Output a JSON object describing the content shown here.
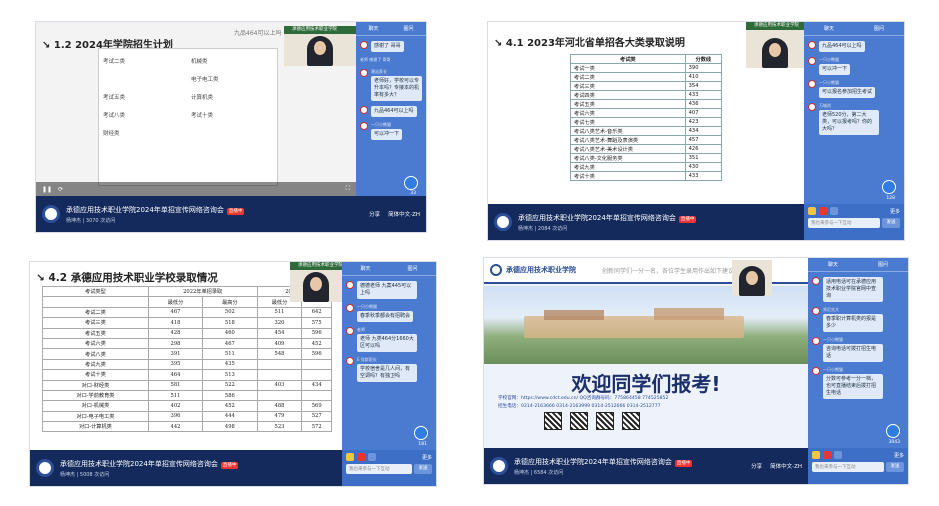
{
  "footer": {
    "title": "承德应用技术职业学院2024年单招宣传网络咨询会",
    "live": "直播中",
    "author": "杨坤杰",
    "visits": [
      "3070 次访问",
      "2084 次访问",
      "5008 次访问",
      "6584 次访问"
    ],
    "share": "分享",
    "lang": "简体中文-ZH",
    "more": "更多"
  },
  "chat": {
    "tabs": [
      "聊天",
      "图问"
    ],
    "placeholder": "我也来参与一下互动",
    "send": "发送"
  },
  "webcam_label": "承德应用技术职业学院",
  "panel1": {
    "title": "1.2  2024年学院招生计划",
    "overlay": "九品464可以上吗",
    "doc_heads": [
      "考试二类",
      "机械类",
      "电子电工类",
      "考试五类",
      "计算机类",
      "考试八类",
      "考试十类",
      "财经类"
    ],
    "messages": [
      {
        "user": "",
        "text": "感谢了 哥哥"
      },
      {
        "user": "老师 感谢了 哥哥",
        "text": ""
      },
      {
        "user": "潮汕家长",
        "text": "老师好，学校可以专升本吗？专接本的机率有多大？"
      },
      {
        "user": "",
        "text": "九品464可以上吗"
      },
      {
        "user": "一只小熊猫",
        "text": "可以冲一下"
      }
    ],
    "likes": "33"
  },
  "panel2": {
    "title": "4.1 2023年河北省单招各大类录取说明",
    "table": {
      "headers": [
        "考试类",
        "分数线"
      ],
      "rows": [
        [
          "考试一类",
          "390"
        ],
        [
          "考试二类",
          "410"
        ],
        [
          "考试三类",
          "354"
        ],
        [
          "考试四类",
          "433"
        ],
        [
          "考试五类",
          "436"
        ],
        [
          "考试六类",
          "407"
        ],
        [
          "考试七类",
          "423"
        ],
        [
          "考试八类艺术-音乐类",
          "434"
        ],
        [
          "考试八类艺术-舞蹈及表演类",
          "457"
        ],
        [
          "考试八类艺术-美术设计类",
          "426"
        ],
        [
          "考试八类-文化服务类",
          "351"
        ],
        [
          "考试九类",
          "430"
        ],
        [
          "考试十类",
          "433"
        ]
      ]
    },
    "messages": [
      {
        "user": "",
        "text": "九品464可以上吗"
      },
      {
        "user": "一只小熊猫",
        "text": "可以冲一下"
      },
      {
        "user": "一只小熊猫",
        "text": "可以报名参加招生考试"
      },
      {
        "user": "万城尚",
        "text": "老师520分，第二大类，可以报考吗？你的大吗？"
      }
    ],
    "likes": "128"
  },
  "panel3": {
    "title": "4.2 承德应用技术职业学校录取情况",
    "table": {
      "headers": [
        "考试类型",
        "2022年单招录取",
        "",
        "2023年",
        ""
      ],
      "sub": [
        "",
        "最低分",
        "最高分",
        "最低分",
        ""
      ],
      "rows": [
        [
          "考试二类",
          "467",
          "502",
          "511",
          "642"
        ],
        [
          "考试三类",
          "418",
          "518",
          "320",
          "575"
        ],
        [
          "考试五类",
          "428",
          "460",
          "454",
          "596"
        ],
        [
          "考试六类",
          "298",
          "467",
          "409",
          "452"
        ],
        [
          "考试八类",
          "391",
          "511",
          "548",
          "596"
        ],
        [
          "考试九类",
          "395",
          "435",
          "",
          ""
        ],
        [
          "考试十类",
          "464",
          "513",
          "",
          ""
        ],
        [
          "对口-财经类",
          "581",
          "522",
          "403",
          "434"
        ],
        [
          "对口-学前教育类",
          "511",
          "586",
          "",
          ""
        ],
        [
          "对口-机械类",
          "402",
          "452",
          "488",
          "569"
        ],
        [
          "对口-电子电工类",
          "396",
          "444",
          "479",
          "527"
        ],
        [
          "对口-计算机类",
          "442",
          "498",
          "523",
          "572"
        ]
      ]
    },
    "messages": [
      {
        "user": "",
        "text": "德德老师 九案445可以上吗"
      },
      {
        "user": "一只小熊猫",
        "text": "春季秋季都会有招聘会"
      },
      {
        "user": "老师",
        "text": "老师 九类464分1660大区可以吗"
      },
      {
        "user": "E 党群家长",
        "text": "学校宿舍是几人间，有空调吗？有独卫吗"
      }
    ],
    "likes": "181"
  },
  "panel4": {
    "banner_school": "承德应用技术职业学院",
    "banner_top": "创新同学们一分一名，各位学生录用作出如下建议",
    "headline": "欢迎同学们报考!",
    "site": "学校官网：https://www.cdct.edu.cn/  QQ咨询群号码：775864458  774525852",
    "phone": "招生电话：0314-2163666  0314-2163999  0314-2512666  0314-2512777",
    "messages": [
      {
        "user": "",
        "text": "适用电话可在承德应用技术职业学院官网中查询"
      },
      {
        "user": "肯尼先大",
        "text": "春季职计算机类的报是多少"
      },
      {
        "user": "一只小熊猫",
        "text": "咨询电话可拨打招生电话"
      },
      {
        "user": "一只小熊猫",
        "text": "分数可参考一分一档，也可直播结束后拨打招生电话"
      }
    ],
    "likes": "3043"
  },
  "colors": {
    "chat": "#4a7bd0",
    "footer": "#142a5c",
    "accent": "#2f7de1"
  },
  "icons": [
    "logo-icon",
    "share-icon",
    "globe-icon",
    "gift-icon",
    "thumbs-up-icon",
    "menu-icon"
  ]
}
